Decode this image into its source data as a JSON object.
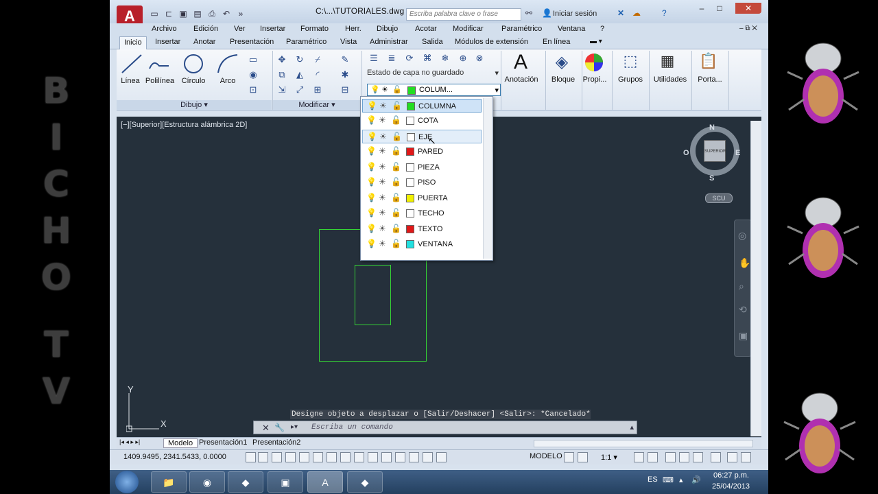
{
  "side_watermark": {
    "letters": [
      "B",
      "I",
      "C",
      "H",
      "O",
      "T",
      "V"
    ]
  },
  "titlebar": {
    "file": "C:\\...\\TUTORIALES.dwg",
    "search_placeholder": "Escriba palabra clave o frase",
    "signin": "Iniciar sesión"
  },
  "menubar": [
    "Archivo",
    "Edición",
    "Ver",
    "Insertar",
    "Formato",
    "Herr.",
    "Dibujo",
    "Acotar",
    "Modificar",
    "Paramétrico",
    "Ventana",
    "?"
  ],
  "tabs": [
    "Inicio",
    "Insertar",
    "Anotar",
    "Presentación",
    "Paramétrico",
    "Vista",
    "Administrar",
    "Salida",
    "Módulos de extensión",
    "En línea"
  ],
  "ribbon": {
    "draw_tools": [
      "Línea",
      "Polilínea",
      "Círculo",
      "Arco"
    ],
    "panels": {
      "draw": "Dibujo",
      "modify": "Modificar"
    },
    "layer_state": "Estado de capa no guardado",
    "current_layer": "COLUM...",
    "right_tools": [
      "Anotación",
      "Bloque",
      "Propi...",
      "Grupos",
      "Utilidades",
      "Porta..."
    ]
  },
  "layers": [
    {
      "name": "COLUMNA",
      "color": "#22dd22"
    },
    {
      "name": "COTA",
      "color": "#ffffff"
    },
    {
      "name": "EJE",
      "color": "#ffffff"
    },
    {
      "name": "PARED",
      "color": "#e01818"
    },
    {
      "name": "PIEZA",
      "color": "#ffffff"
    },
    {
      "name": "PISO",
      "color": "#ffffff"
    },
    {
      "name": "PUERTA",
      "color": "#f0f000"
    },
    {
      "name": "TECHO",
      "color": "#ffffff"
    },
    {
      "name": "TEXTO",
      "color": "#e01818"
    },
    {
      "name": "VENTANA",
      "color": "#22e0e0"
    }
  ],
  "viewport": {
    "label": "[−][Superior][Estructura alámbrica 2D]",
    "viewcube": {
      "n": "N",
      "s": "S",
      "e": "E",
      "o": "O",
      "face": "SUPERIOR"
    },
    "scu": "SCU",
    "ucs_y": "Y",
    "ucs_x": "X"
  },
  "command": {
    "history": "Designe objeto a desplazar o [Salir/Deshacer] <Salir>: *Cancelado*",
    "placeholder": "Escriba un comando"
  },
  "layout_tabs": [
    "Modelo",
    "Presentación1",
    "Presentación2"
  ],
  "status": {
    "coords": "1409.9495, 2341.5433, 0.0000",
    "mode": "MODELO",
    "scale": "1:1"
  },
  "taskbar": {
    "lang": "ES",
    "time": "06:27 p.m.",
    "date": "25/04/2013"
  }
}
